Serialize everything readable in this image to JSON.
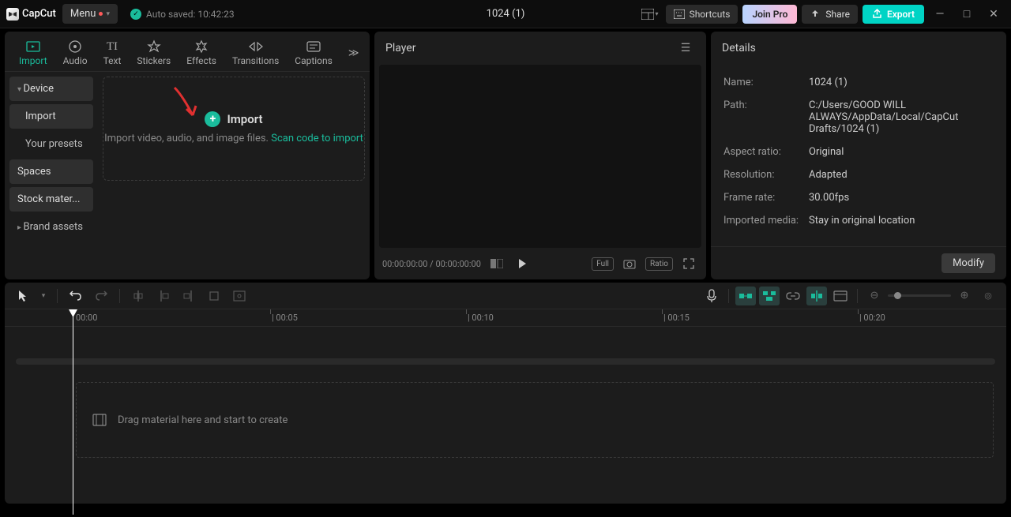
{
  "titlebar": {
    "logo": "CapCut",
    "menu": "Menu",
    "autosave": "Auto saved: 10:42:23",
    "project_title": "1024 (1)",
    "shortcuts": "Shortcuts",
    "join_pro": "Join Pro",
    "share": "Share",
    "export": "Export"
  },
  "tabs": {
    "import": "Import",
    "audio": "Audio",
    "text": "Text",
    "stickers": "Stickers",
    "effects": "Effects",
    "transitions": "Transitions",
    "captions": "Captions"
  },
  "sidebar": {
    "device": "Device",
    "import": "Import",
    "presets": "Your presets",
    "spaces": "Spaces",
    "stock": "Stock mater...",
    "brand": "Brand assets"
  },
  "import_box": {
    "title": "Import",
    "desc_a": "Import video, audio, and image files. ",
    "desc_b": "Scan code to import"
  },
  "player": {
    "title": "Player",
    "time": "00:00:00:00 / 00:00:00:00",
    "full": "Full",
    "ratio": "Ratio"
  },
  "details": {
    "title": "Details",
    "labels": {
      "name": "Name:",
      "path": "Path:",
      "aspect": "Aspect ratio:",
      "resolution": "Resolution:",
      "framerate": "Frame rate:",
      "imported": "Imported media:"
    },
    "values": {
      "name": "1024 (1)",
      "path": "C:/Users/GOOD WILL ALWAYS/AppData/Local/CapCut Drafts/1024 (1)",
      "aspect": "Original",
      "resolution": "Adapted",
      "framerate": "30.00fps",
      "imported": "Stay in original location"
    },
    "modify": "Modify"
  },
  "timeline": {
    "marks": [
      "00:00",
      "| 00:05",
      "| 00:10",
      "| 00:15",
      "| 00:20"
    ],
    "placeholder": "Drag material here and start to create"
  }
}
